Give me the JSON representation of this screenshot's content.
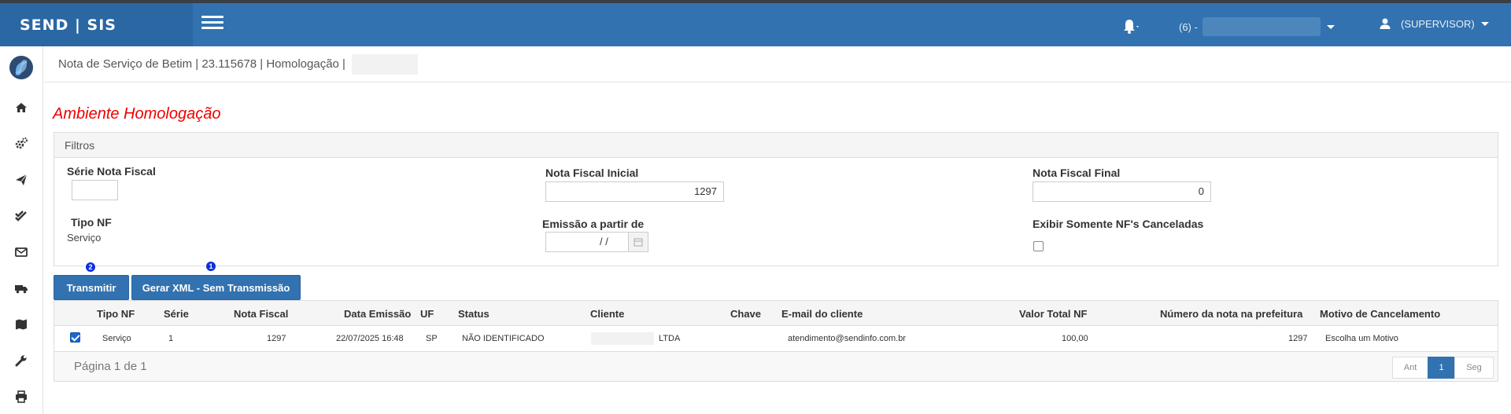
{
  "app": {
    "brand": "SEND | SIS",
    "company_label": "(6) -",
    "user_label": "(SUPERVISOR)"
  },
  "breadcrumb": {
    "text": "Nota de Serviço de Betim | 23.115678 | Homologação |"
  },
  "environment_title": "Ambiente Homologação",
  "filters": {
    "panel_title": "Filtros",
    "serie_label": "Série Nota Fiscal",
    "serie_value": "",
    "nf_inicial_label": "Nota Fiscal Inicial",
    "nf_inicial_value": "1297",
    "nf_final_label": "Nota Fiscal Final",
    "nf_final_value": "0",
    "tipo_nf_label": "Tipo NF",
    "tipo_nf_value": "Serviço",
    "emissao_label": "Emissão a partir de",
    "emissao_value": "/ /",
    "canceladas_label": "Exibir Somente NF's Canceladas",
    "canceladas_checked": false
  },
  "actions": {
    "transmitir_label": "Transmitir",
    "transmitir_badge": "2",
    "gerar_xml_label": "Gerar XML - Sem Transmissão",
    "gerar_xml_badge": "1"
  },
  "table": {
    "headers": {
      "tipo_nf": "Tipo NF",
      "serie": "Série",
      "nota_fiscal": "Nota Fiscal",
      "data_emissao": "Data Emissão",
      "uf": "UF",
      "status": "Status",
      "cliente": "Cliente",
      "chave": "Chave",
      "email": "E-mail do cliente",
      "valor_total": "Valor Total NF",
      "numero_prefeitura": "Número da nota na prefeitura",
      "motivo": "Motivo de Cancelamento"
    },
    "rows": [
      {
        "checked": true,
        "tipo_nf": "Serviço",
        "serie": "1",
        "nota_fiscal": "1297",
        "data_emissao": "22/07/2025 16:48",
        "uf": "SP",
        "status": "NÃO IDENTIFICADO",
        "cliente": "LTDA",
        "chave": "",
        "email": "atendimento@sendinfo.com.br",
        "valor_total": "100,00",
        "numero_prefeitura": "1297",
        "motivo": "Escolha um Motivo"
      }
    ],
    "page_info": "Página 1 de 1",
    "pager": {
      "prev": "Ant",
      "current": "1",
      "next": "Seg"
    }
  },
  "colors": {
    "primary": "#3272b0",
    "brand_bg": "#2a67a3",
    "env_title": "#ee0000",
    "badge": "#0a2ee0"
  }
}
